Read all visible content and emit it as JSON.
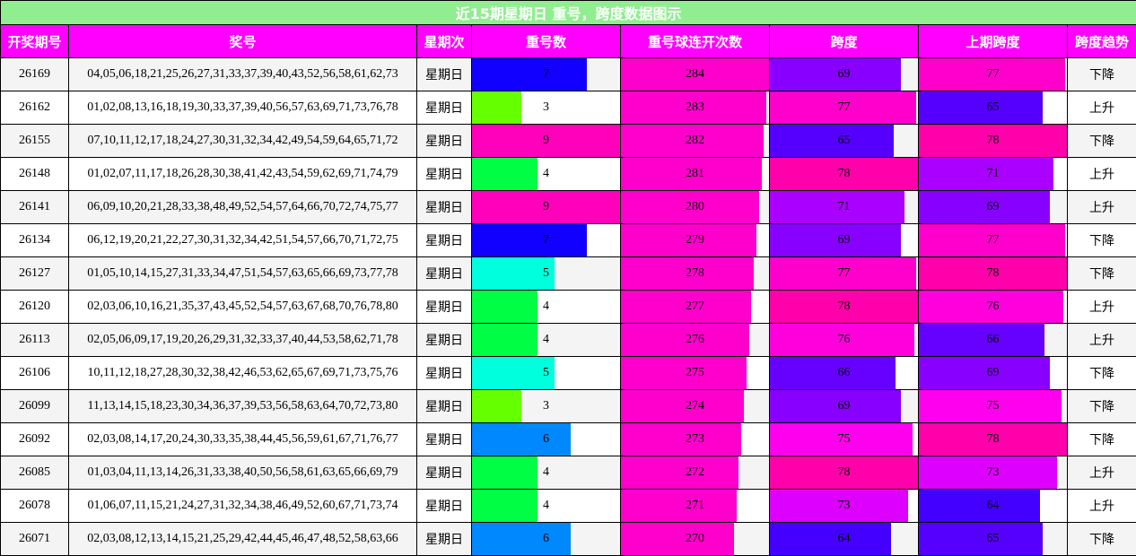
{
  "chart_data": {
    "type": "table",
    "title": "近15期星期日 重号，跨度数据图示",
    "columns": [
      "开奖期号",
      "奖号",
      "星期次",
      "重号数",
      "重号球连开次数",
      "跨度",
      "上期跨度",
      "跨度趋势"
    ],
    "rows": [
      {
        "issue": "26169",
        "numbers": "04,05,06,18,21,25,26,27,31,33,37,39,40,43,52,56,58,61,62,73",
        "weekday": "星期日",
        "repeat": 7,
        "streak": 284,
        "span": 69,
        "prev_span": 77,
        "trend": "下降"
      },
      {
        "issue": "26162",
        "numbers": "01,02,08,13,16,18,19,30,33,37,39,40,56,57,63,69,71,73,76,78",
        "weekday": "星期日",
        "repeat": 3,
        "streak": 283,
        "span": 77,
        "prev_span": 65,
        "trend": "上升"
      },
      {
        "issue": "26155",
        "numbers": "07,10,11,12,17,18,24,27,30,31,32,34,42,49,54,59,64,65,71,72",
        "weekday": "星期日",
        "repeat": 9,
        "streak": 282,
        "span": 65,
        "prev_span": 78,
        "trend": "下降"
      },
      {
        "issue": "26148",
        "numbers": "01,02,07,11,17,18,26,28,30,38,41,42,43,54,59,62,69,71,74,79",
        "weekday": "星期日",
        "repeat": 4,
        "streak": 281,
        "span": 78,
        "prev_span": 71,
        "trend": "上升"
      },
      {
        "issue": "26141",
        "numbers": "06,09,10,20,21,28,33,38,48,49,52,54,57,64,66,70,72,74,75,77",
        "weekday": "星期日",
        "repeat": 9,
        "streak": 280,
        "span": 71,
        "prev_span": 69,
        "trend": "上升"
      },
      {
        "issue": "26134",
        "numbers": "06,12,19,20,21,22,27,30,31,32,34,42,51,54,57,66,70,71,72,75",
        "weekday": "星期日",
        "repeat": 7,
        "streak": 279,
        "span": 69,
        "prev_span": 77,
        "trend": "下降"
      },
      {
        "issue": "26127",
        "numbers": "01,05,10,14,15,27,31,33,34,47,51,54,57,63,65,66,69,73,77,78",
        "weekday": "星期日",
        "repeat": 5,
        "streak": 278,
        "span": 77,
        "prev_span": 78,
        "trend": "下降"
      },
      {
        "issue": "26120",
        "numbers": "02,03,06,10,16,21,35,37,43,45,52,54,57,63,67,68,70,76,78,80",
        "weekday": "星期日",
        "repeat": 4,
        "streak": 277,
        "span": 78,
        "prev_span": 76,
        "trend": "上升"
      },
      {
        "issue": "26113",
        "numbers": "02,05,06,09,17,19,20,26,29,31,32,33,37,40,44,53,58,62,71,78",
        "weekday": "星期日",
        "repeat": 4,
        "streak": 276,
        "span": 76,
        "prev_span": 66,
        "trend": "上升"
      },
      {
        "issue": "26106",
        "numbers": "10,11,12,18,27,28,30,32,38,42,46,53,62,65,67,69,71,73,75,76",
        "weekday": "星期日",
        "repeat": 5,
        "streak": 275,
        "span": 66,
        "prev_span": 69,
        "trend": "下降"
      },
      {
        "issue": "26099",
        "numbers": "11,13,14,15,18,23,30,34,36,37,39,53,56,58,63,64,70,72,73,80",
        "weekday": "星期日",
        "repeat": 3,
        "streak": 274,
        "span": 69,
        "prev_span": 75,
        "trend": "下降"
      },
      {
        "issue": "26092",
        "numbers": "02,03,08,14,17,20,24,30,33,35,38,44,45,56,59,61,67,71,76,77",
        "weekday": "星期日",
        "repeat": 6,
        "streak": 273,
        "span": 75,
        "prev_span": 78,
        "trend": "下降"
      },
      {
        "issue": "26085",
        "numbers": "01,03,04,11,13,14,26,31,33,38,40,50,56,58,61,63,65,66,69,79",
        "weekday": "星期日",
        "repeat": 4,
        "streak": 272,
        "span": 78,
        "prev_span": 73,
        "trend": "上升"
      },
      {
        "issue": "26078",
        "numbers": "01,06,07,11,15,21,24,27,31,32,34,38,46,49,52,60,67,71,73,74",
        "weekday": "星期日",
        "repeat": 4,
        "streak": 271,
        "span": 73,
        "prev_span": 64,
        "trend": "上升"
      },
      {
        "issue": "26071",
        "numbers": "02,03,08,12,13,14,15,21,25,29,42,44,45,46,47,48,52,58,63,66",
        "weekday": "星期日",
        "repeat": 6,
        "streak": 270,
        "span": 64,
        "prev_span": 65,
        "trend": "下降"
      }
    ],
    "scales": {
      "repeat_max": 9,
      "streak_max": 284,
      "span_max": 78
    },
    "colors": {
      "title_bg": "#90ee90",
      "header_bg": "#ff00ff",
      "alt_row_bg": "#f4f4f4",
      "repeat": {
        "3": "#66ff00",
        "4": "#00ff44",
        "5": "#00ffdd",
        "6": "#0088ff",
        "7": "#1100ff",
        "9": "#ff00bb"
      },
      "streak": "#ff00cc",
      "span": {
        "64": "#4400ff",
        "65": "#5500ff",
        "66": "#6600ff",
        "69": "#8800ff",
        "71": "#aa00ff",
        "73": "#dd00ff",
        "75": "#ff00ee",
        "76": "#ff00dd",
        "77": "#ff00cc",
        "78": "#ff00aa"
      }
    }
  }
}
